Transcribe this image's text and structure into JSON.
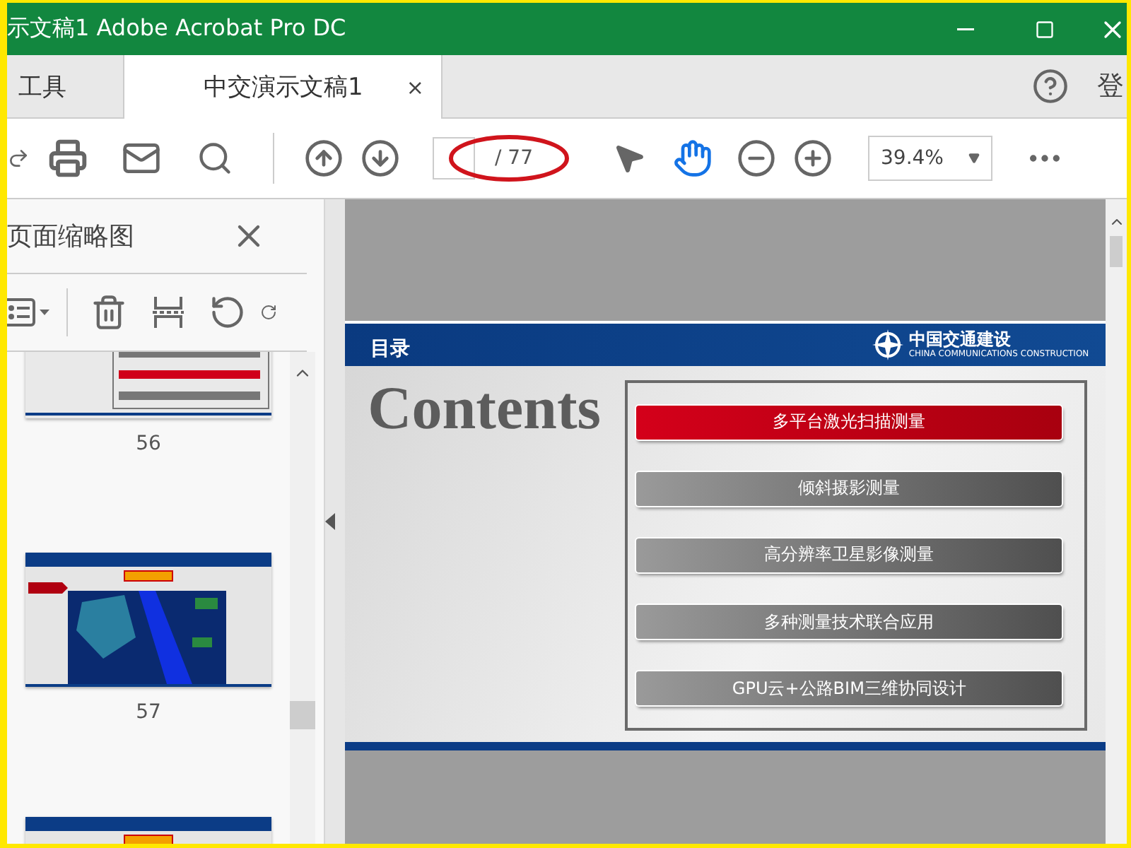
{
  "window": {
    "title": "示文稿1 Adobe Acrobat Pro DC"
  },
  "tabs": [
    {
      "label": "工具",
      "selected": false
    },
    {
      "label": "中交演示文稿1",
      "selected": true,
      "close_glyph": "×"
    }
  ],
  "account": {
    "login": "登"
  },
  "toolbar": {
    "page_total": "/ 77",
    "zoom": "39.4%"
  },
  "sidebar": {
    "title": "页面缩略图",
    "thumbnails": [
      {
        "kind": "contents",
        "label": "56"
      },
      {
        "kind": "photo",
        "label": "57"
      },
      {
        "kind": "photo"
      }
    ]
  },
  "slide": {
    "header": "目录",
    "logo_name": "中国交通建设",
    "logo_sub": "CHINA COMMUNICATIONS CONSTRUCTION",
    "heading": "Contents",
    "items": [
      {
        "label": "多平台激光扫描测量",
        "selected": true
      },
      {
        "label": "倾斜摄影测量",
        "selected": false
      },
      {
        "label": "高分辨率卫星影像测量",
        "selected": false
      },
      {
        "label": "多种测量技术联合应用",
        "selected": false
      },
      {
        "label": "GPU云+公路BIM三维协同设计",
        "selected": false
      }
    ]
  }
}
